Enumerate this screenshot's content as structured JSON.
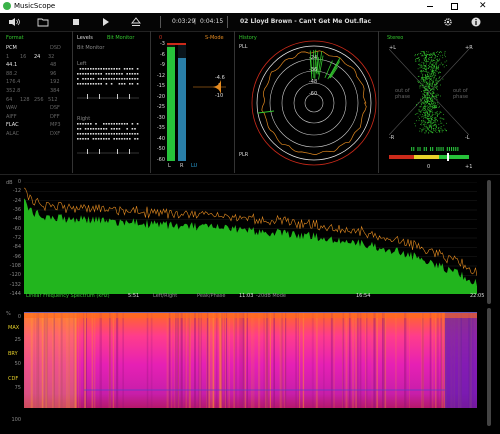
{
  "window": {
    "title": "MusicScope"
  },
  "toolbar": {
    "elapsed": "0:03:29",
    "separator": "|",
    "total": "0:04:15",
    "track": "02 Lloyd Brown - Can't Get Me Out.flac"
  },
  "format": {
    "title": "Format",
    "rows": [
      [
        "PCM",
        "DSD"
      ],
      [
        "1",
        "16",
        "24",
        "32"
      ],
      [
        "44.1",
        "48"
      ],
      [
        "88.2",
        "96"
      ],
      [
        "176.4",
        "192"
      ],
      [
        "352.8",
        "384"
      ],
      [
        "64",
        "128",
        "256",
        "512"
      ],
      [
        "WAV",
        "DSF"
      ],
      [
        "AIFF",
        "DFF"
      ],
      [
        "FLAC",
        "MP3"
      ],
      [
        "ALAC",
        "DXF"
      ]
    ]
  },
  "levels": {
    "title": "Levels",
    "subtitle": "Bit Monitor",
    "bit_monitor_label": "Bit Monitor",
    "left_label": "Left",
    "right_label": "Right"
  },
  "meters": {
    "header_left": "0",
    "header_right": "S-Mode",
    "scale": [
      "-3",
      "-6",
      "-9",
      "-12",
      "-15",
      "-20",
      "-25",
      "-30",
      "-35",
      "-40",
      "-50",
      "-60"
    ],
    "labels_bottom": [
      "L",
      "R",
      "LU"
    ],
    "peak_value": "-4.6",
    "side_scale": [
      "3",
      "-10"
    ],
    "left_level_fraction": 0.98,
    "right_level_fraction": 0.89
  },
  "history": {
    "title": "History",
    "label_top": "PLL",
    "label_bottom": "PLR",
    "rings": [
      "-24",
      "-36",
      "-48",
      "-60"
    ]
  },
  "stereo": {
    "title": "Stereo",
    "plus_l": "+L",
    "plus_r": "+R",
    "minus_l": "-L",
    "minus_r": "-R",
    "out_of_phase_left": "out of phase",
    "out_of_phase_right": "out of phase",
    "balance_zero": "0",
    "balance_plus": "+1"
  },
  "spectrum": {
    "unit": "dB",
    "y_ticks": [
      "0",
      "-12",
      "-24",
      "-36",
      "-48",
      "-60",
      "-72",
      "-84",
      "-96",
      "-108",
      "-120",
      "-132",
      "-144"
    ],
    "x_ticks": [
      "5:51",
      "11:03",
      "16:54",
      "22:05"
    ],
    "footer_labels": [
      "Linear Frequency Spectrum (kHz)",
      "Left/Right",
      "Peak/Phase",
      "-20dB Mode"
    ]
  },
  "spectrogram": {
    "unit": "%",
    "y_ticks": [
      "0",
      "25",
      "50",
      "75",
      "100"
    ],
    "markers": [
      "MAX",
      "BRY",
      "CDF"
    ]
  },
  "colors": {
    "accent_green": "#34c72f",
    "accent_orange": "#e38a20",
    "meter_blue": "#2a7fa8",
    "meter_green": "#27c23a",
    "peak_red": "#cc2a1a"
  }
}
